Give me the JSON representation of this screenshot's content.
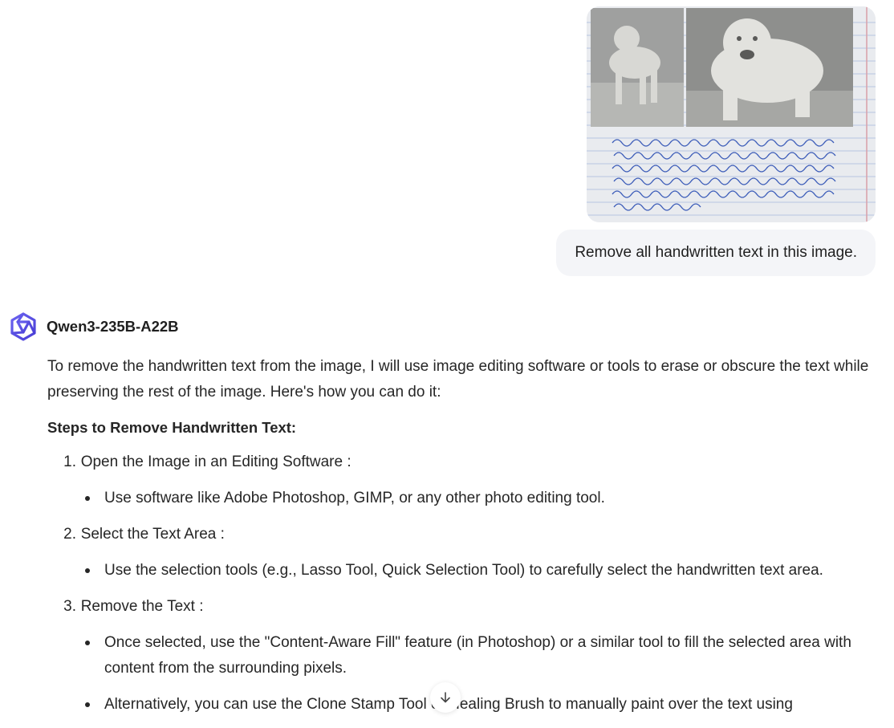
{
  "user_message": {
    "image_text": "The bulldog has got bigger in its body, because humans th have been over-feeding the dog. It has a longer body, the advantage is so it could walk faster. The nose has been squashed because humans thought it looked nicer.",
    "text": "Remove all handwritten text in this image."
  },
  "assistant": {
    "model_name": "Qwen3-235B-A22B",
    "avatar_icon": "qwen-logo-icon",
    "intro": "To remove the handwritten text from the image, I will use image editing software or tools to erase or obscure the text while preserving the rest of the image. Here's how you can do it:",
    "steps_heading": "Steps to Remove Handwritten Text:",
    "steps": [
      {
        "number": "1.",
        "title": "Open the Image in an Editing Software :",
        "bullets": [
          "Use software like Adobe Photoshop, GIMP, or any other photo editing tool."
        ]
      },
      {
        "number": "2.",
        "title": "Select the Text Area :",
        "bullets": [
          "Use the selection tools (e.g., Lasso Tool, Quick Selection Tool) to carefully select the handwritten text area."
        ]
      },
      {
        "number": "3.",
        "title": "Remove the Text :",
        "bullets": [
          "Once selected, use the \"Content-Aware Fill\" feature (in Photoshop) or a similar tool to fill the selected area with content from the surrounding pixels.",
          "Alternatively, you can use the Clone Stamp Tool or Healing Brush to manually paint over the text using"
        ]
      }
    ]
  },
  "controls": {
    "scroll_down_icon": "arrow-down-icon"
  },
  "colors": {
    "accent": "#615ced",
    "bubble_bg": "#f4f5f8",
    "ink": "#2a4fb0"
  }
}
